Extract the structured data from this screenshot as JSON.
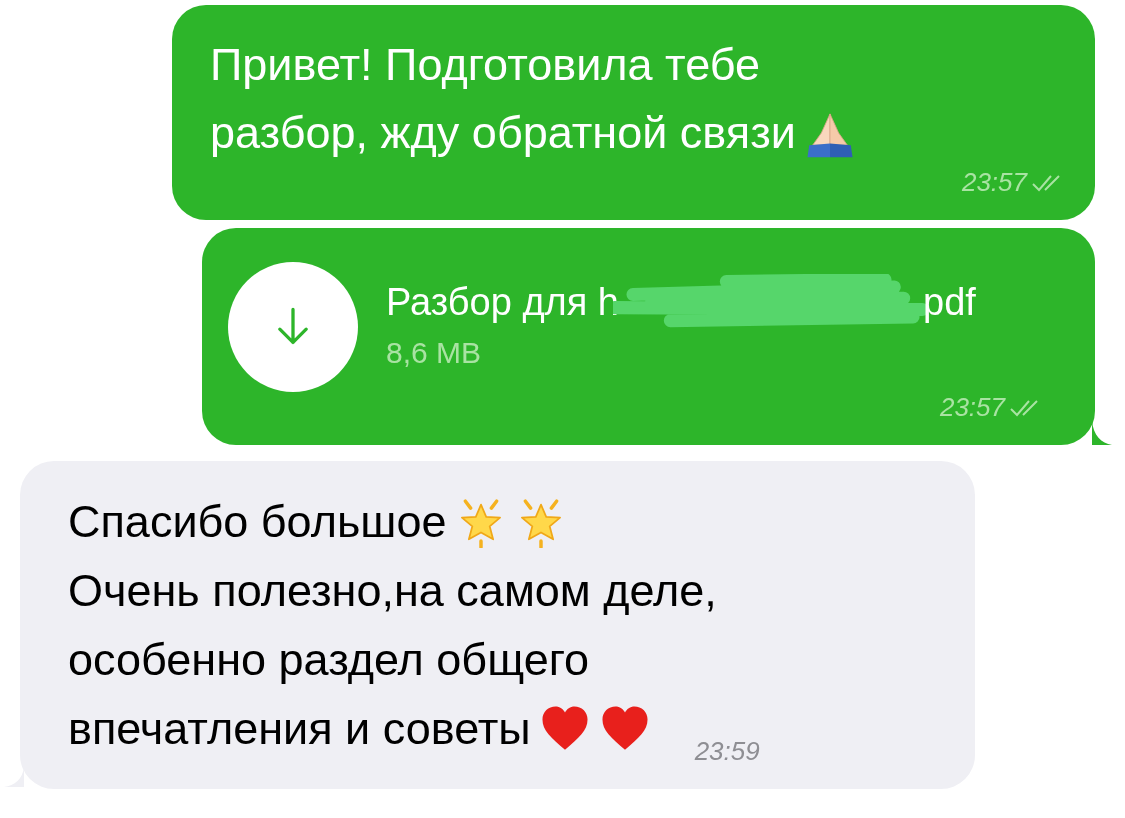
{
  "messages": [
    {
      "kind": "text",
      "outgoing": true,
      "lines": [
        [
          {
            "kind": "text",
            "text": "Привет! Подготовила тебе"
          }
        ],
        [
          {
            "kind": "text",
            "text": "разбор, жду обратной связи"
          },
          {
            "kind": "pray"
          }
        ]
      ],
      "time": "23:57",
      "read": true
    },
    {
      "kind": "file",
      "outgoing": true,
      "name_start": "Разбор для h",
      "redacted": true,
      "name_end": "pdf",
      "size": "8,6 MB",
      "time": "23:57",
      "read": true
    },
    {
      "kind": "text",
      "outgoing": false,
      "lines": [
        [
          {
            "kind": "text",
            "text": "Спасибо большое"
          },
          {
            "kind": "star"
          },
          {
            "kind": "star"
          }
        ],
        [
          {
            "kind": "text",
            "text": "Очень полезно,на самом деле,"
          }
        ],
        [
          {
            "kind": "text",
            "text": "особенно раздел общего"
          }
        ],
        [
          {
            "kind": "text",
            "text": "впечатления и советы"
          },
          {
            "kind": "heart"
          },
          {
            "kind": "heart"
          }
        ]
      ],
      "time": "23:59"
    }
  ]
}
